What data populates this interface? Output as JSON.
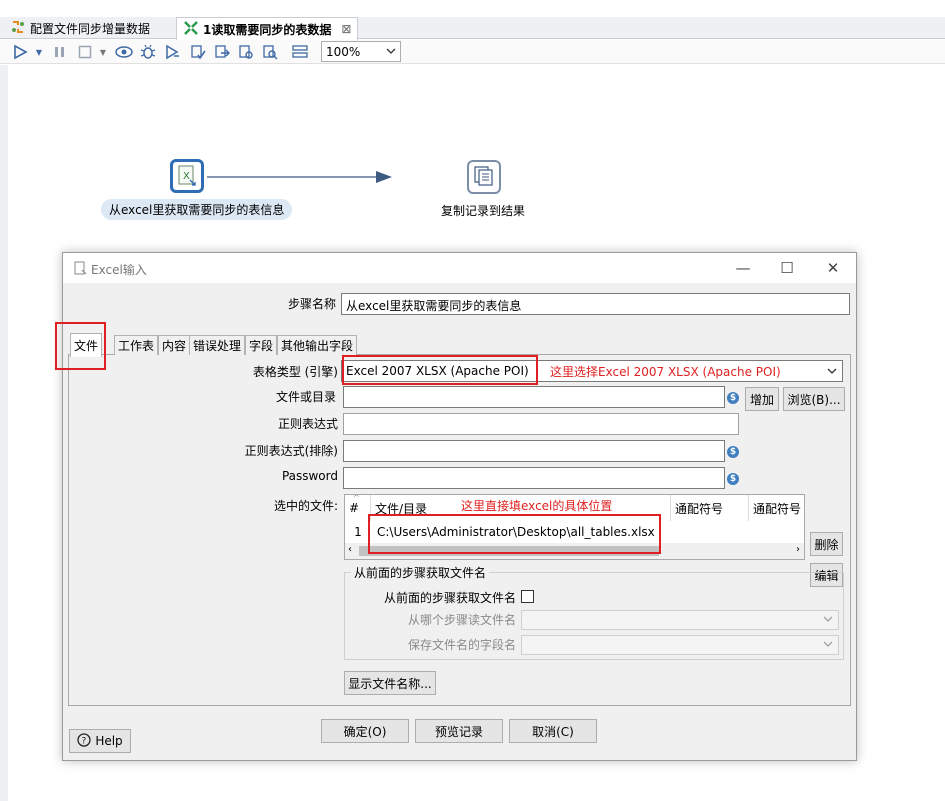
{
  "editor_tabs": [
    {
      "label": "配置文件同步增量数据",
      "icon": "transformation-icon",
      "active": false
    },
    {
      "label": "1读取需要同步的表数据",
      "icon": "transformation-icon",
      "active": true,
      "close": "⊠"
    }
  ],
  "toolbar": {
    "zoom": "100%",
    "icons": [
      "run-icon",
      "dropdown-icon",
      "pause-icon",
      "stop-icon",
      "dropdown-icon",
      "preview-icon",
      "debug-icon",
      "replay-icon",
      "verify-icon",
      "impact-icon",
      "sql-icon",
      "explore-db-icon",
      "show-results-icon"
    ]
  },
  "canvas": {
    "nodes": [
      {
        "label": "从excel里获取需要同步的表信息",
        "icon": "excel-input-icon",
        "selected": true
      },
      {
        "label": "复制记录到结果",
        "icon": "copy-rows-icon",
        "selected": false
      }
    ],
    "hop_color": "#3d5a80"
  },
  "dialog": {
    "title": "Excel输入",
    "window_controls": {
      "minimize": "—",
      "maximize": "☐",
      "close": "✕"
    },
    "step_name_label": "步骤名称",
    "step_name_value": "从excel里获取需要同步的表信息",
    "tabs": [
      "文件",
      "工作表",
      "内容",
      "错误处理",
      "字段",
      "其他输出字段"
    ],
    "active_tab": "文件",
    "fields": {
      "engine_label": "表格类型 (引擎)",
      "engine_value": "Excel 2007 XLSX (Apache POI)",
      "file_or_dir_label": "文件或目录",
      "file_or_dir_value": "",
      "regex_label": "正则表达式",
      "regex_value": "",
      "regex_exclude_label": "正则表达式(排除)",
      "regex_exclude_value": "",
      "password_label": "Password",
      "password_value": "",
      "selected_files_label": "选中的文件:"
    },
    "buttons": {
      "add": "增加",
      "browse": "浏览(B)...",
      "delete": "删除",
      "edit": "编辑",
      "show_filenames": "显示文件名称...",
      "ok": "确定(O)",
      "preview": "预览记录",
      "cancel": "取消(C)",
      "help": "Help"
    },
    "file_table": {
      "columns": [
        "#",
        "文件/目录",
        "通配符号",
        "通配符号"
      ],
      "rows": [
        {
          "num": "1",
          "path": "C:\\Users\\Administrator\\Desktop\\all_tables.xlsx",
          "wildcard": "",
          "wildcard2": ""
        }
      ]
    },
    "from_previous": {
      "group_title": "从前面的步骤获取文件名",
      "checkbox_label": "从前面的步骤获取文件名",
      "checked": false,
      "step_label": "从哪个步骤读文件名",
      "step_value": "",
      "field_label": "保存文件名的字段名",
      "field_value": ""
    },
    "annotations": {
      "engine_note": "这里选择Excel 2007 XLSX (Apache POI)",
      "file_note": "这里直接填excel的具体位置",
      "color": "#e02020"
    }
  }
}
